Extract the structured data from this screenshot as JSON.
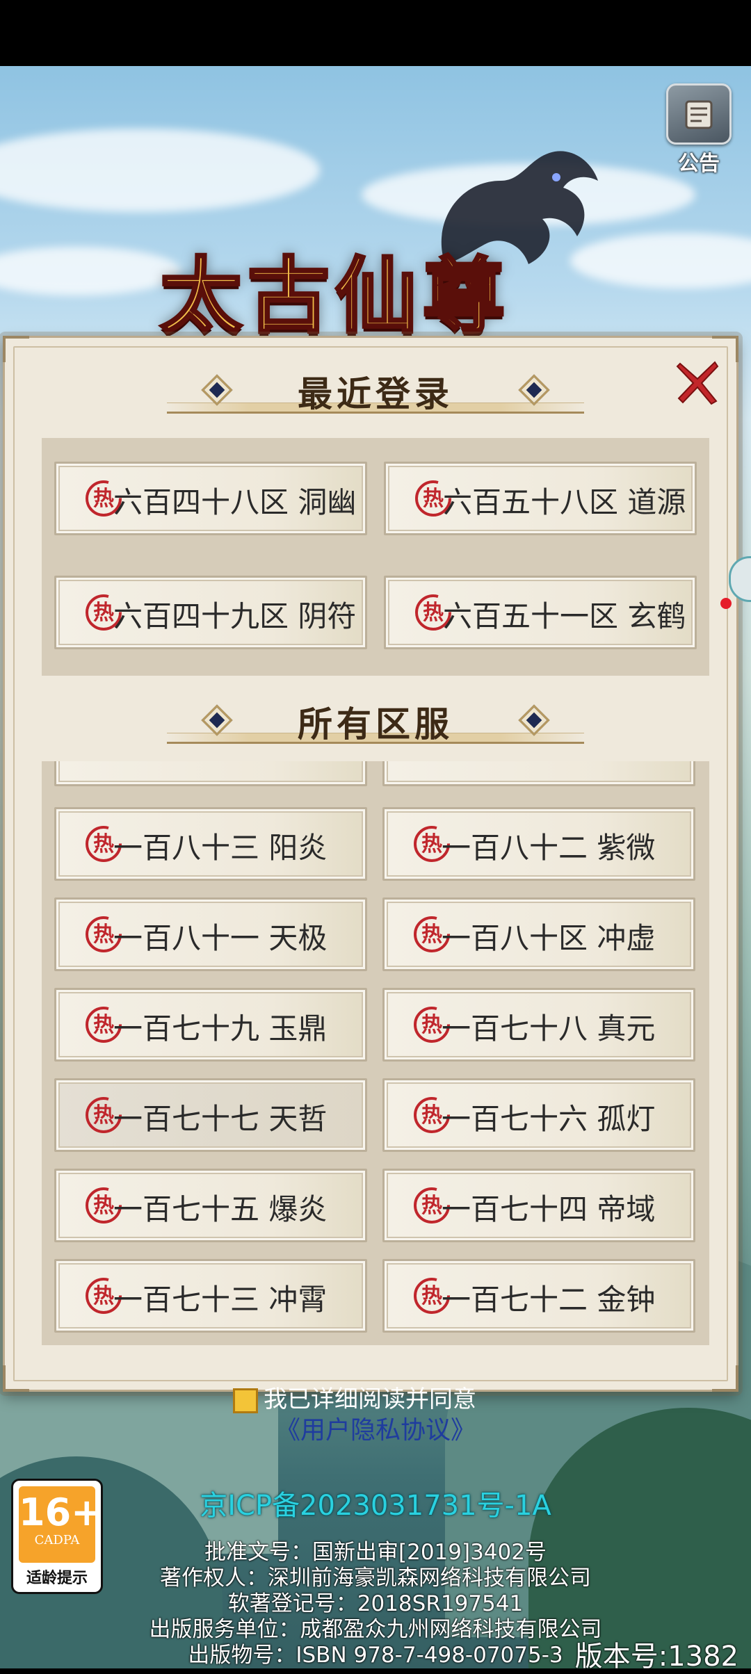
{
  "game": {
    "title_art": "太古仙尊"
  },
  "notice": {
    "label": "公告",
    "icon": "scroll-icon"
  },
  "dialog": {
    "close_icon": "close-x-icon",
    "recent_title": "最近登录",
    "all_title": "所有区服",
    "hot_badge": "热",
    "recent_servers": [
      {
        "label": "六百四十八区 洞幽"
      },
      {
        "label": "六百五十八区 道源"
      },
      {
        "label": "六百四十九区 阴符"
      },
      {
        "label": "六百五十一区 玄鹤"
      }
    ],
    "all_servers": [
      {
        "label": "一百八十三 阳炎"
      },
      {
        "label": "一百八十二 紫微"
      },
      {
        "label": "一百八十一 天极"
      },
      {
        "label": "一百八十区 冲虚"
      },
      {
        "label": "一百七十九 玉鼎"
      },
      {
        "label": "一百七十八 真元"
      },
      {
        "label": "一百七十七 天哲"
      },
      {
        "label": "一百七十六 孤灯"
      },
      {
        "label": "一百七十五 爆炎"
      },
      {
        "label": "一百七十四 帝域"
      },
      {
        "label": "一百七十三  冲霄"
      },
      {
        "label": "一百七十二 金钟"
      }
    ]
  },
  "footer": {
    "agree_text": "我已详细阅读并同意",
    "privacy_link": "《用户隐私协议》",
    "icp": "京ICP备2023031731号-1A",
    "license_lines": [
      "批准文号：国新出审[2019]3402号",
      "著作权人：深圳前海豪凯森网络科技有限公司",
      "软著登记号：2018SR197541",
      "出版服务单位：成都盈众九州网络科技有限公司",
      "出版物号：ISBN 978-7-498-07075-3"
    ],
    "version": "版本号:1382"
  },
  "age_rating": {
    "number": "16+",
    "org": "CADPA",
    "tip": "适龄提示",
    "color": "#f6a32a"
  },
  "colors": {
    "hot_red": "#c0262c",
    "panel": "#d6ccb9",
    "icp_cyan": "#2ad1e0",
    "link_blue": "#1f3c9e"
  }
}
